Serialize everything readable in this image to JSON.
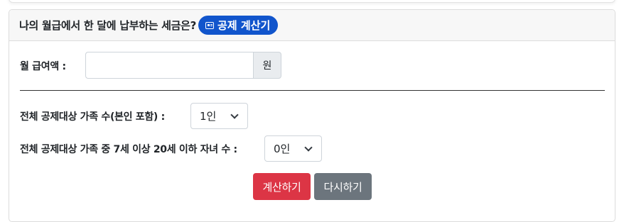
{
  "header": {
    "title": "나의 월급에서 한 달에 납부하는 세금은?",
    "badge_label": "공제 계산기",
    "badge_icon": "card-icon"
  },
  "salary": {
    "label": "월 급여액 :",
    "value": "",
    "unit": "원"
  },
  "family": {
    "label": "전체 공제대상 가족 수(본인 포함) :",
    "selected": "1인"
  },
  "children": {
    "label": "전체 공제대상 가족 중 7세 이상 20세 이하 자녀 수 :",
    "selected": "0인"
  },
  "buttons": {
    "calculate": "계산하기",
    "reset": "다시하기"
  },
  "colors": {
    "badge": "#1155cc",
    "calculate": "#dc3545",
    "reset": "#6c757d"
  }
}
